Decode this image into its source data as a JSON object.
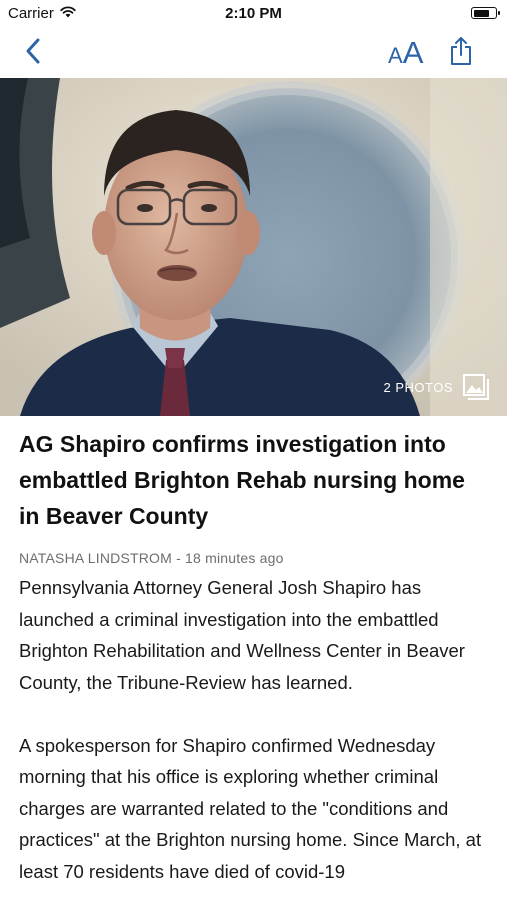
{
  "status_bar": {
    "carrier": "Carrier",
    "time": "2:10 PM",
    "battery_level": 0.75
  },
  "nav": {
    "back_icon": "chevron-left-icon",
    "text_size_small": "A",
    "text_size_large": "A",
    "share_icon": "share-icon",
    "accent_color": "#2d64a8"
  },
  "hero": {
    "photo_count_label": "2 PHOTOS",
    "gallery_icon": "photo-gallery-icon"
  },
  "article": {
    "headline": "AG Shapiro confirms investigation into embattled Brighton Rehab nursing home in Beaver County",
    "byline": "NATASHA LINDSTROM - 18 minutes ago",
    "paragraphs": [
      "Pennsylvania Attorney General Josh Shapiro has launched a criminal investigation into the embattled Brighton Rehabilitation and Wellness Center in Beaver County, the Tribune-Review has learned.",
      "A spokesperson for Shapiro confirmed Wednesday morning that his office is exploring whether criminal charges are warranted related to the \"conditions and practices\" at the Brighton nursing home. Since March, at least 70 residents have died of covid-19"
    ]
  }
}
